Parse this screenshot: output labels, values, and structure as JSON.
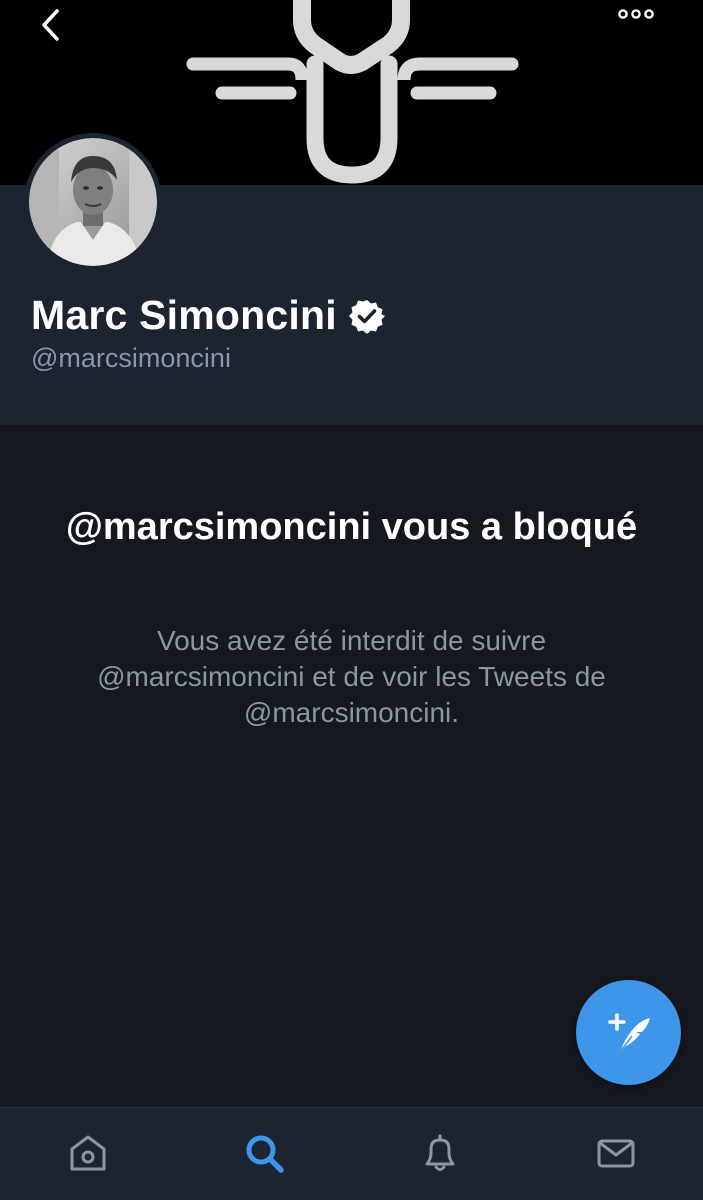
{
  "header": {
    "back_icon": "chevron-left-icon",
    "more_icon": "more-dots-icon"
  },
  "profile": {
    "display_name": "Marc Simoncini",
    "handle": "@marcsimoncini",
    "verified": true
  },
  "blocked": {
    "title": "@marcsimoncini vous a bloqué",
    "description": "Vous avez été interdit de suivre @marcsimoncini et de voir les Tweets de @marcsimoncini."
  },
  "compose": {
    "icon": "compose-tweet-icon"
  },
  "tabbar": {
    "tabs": [
      {
        "id": "home",
        "icon": "home-icon",
        "active": false
      },
      {
        "id": "search",
        "icon": "search-icon",
        "active": true
      },
      {
        "id": "notifications",
        "icon": "bell-icon",
        "active": false
      },
      {
        "id": "messages",
        "icon": "envelope-icon",
        "active": false
      }
    ]
  },
  "colors": {
    "background": "#15181f",
    "card": "#1c2431",
    "accent": "#3d96ea",
    "secondary_text": "#8a97a5",
    "primary_text": "#ffffff"
  }
}
